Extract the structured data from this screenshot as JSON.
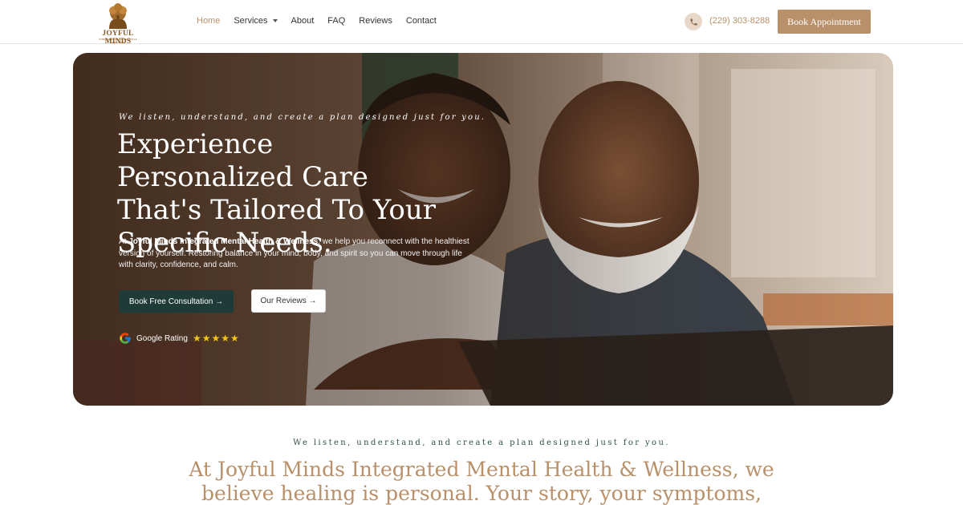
{
  "header": {
    "logo_name": "JOYFUL MINDS",
    "logo_tagline": "INTEGRATED MENTAL HEALTH & WELLNESS",
    "nav": [
      {
        "label": "Home",
        "active": true
      },
      {
        "label": "Services",
        "dropdown": true
      },
      {
        "label": "About"
      },
      {
        "label": "FAQ"
      },
      {
        "label": "Reviews"
      },
      {
        "label": "Contact"
      }
    ],
    "phone": "(229) 303-8288",
    "phone_icon": "phone-icon",
    "book_label": "Book Appointment"
  },
  "hero": {
    "eyebrow": "We listen, understand, and create a plan designed just for you.",
    "title": "Experience Personalized Care That's Tailored To Your Specific Needs.",
    "desc_prefix": "At ",
    "desc_bold": "Joyful Minds Integrated Mental Health & Wellness",
    "desc_suffix": ", we help you reconnect with the healthiest version of yourself. Restoring balance in your mind, body, and spirit so you can move through life with clarity, confidence, and calm.",
    "consult_label": "Book Free Consultation →",
    "reviews_label": "Our Reviews →",
    "rating_label": "Google Rating",
    "rating_stars": 5
  },
  "intro": {
    "eyebrow": "We listen, understand, and create a plan designed just for you.",
    "text": "At Joyful Minds Integrated Mental Health & Wellness, we believe healing is personal. Your story, your symptoms, and your goals all"
  },
  "colors": {
    "accent": "#b8906a",
    "dark_green": "#1f3b38",
    "brand_brown": "#8a5a22",
    "star": "#f5c518"
  }
}
